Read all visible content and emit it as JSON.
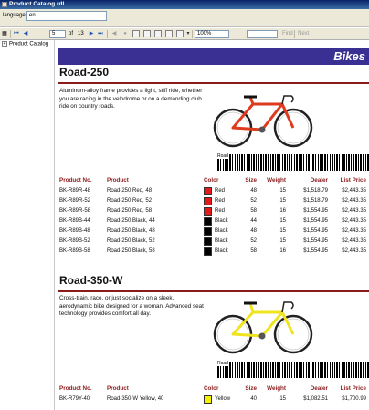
{
  "window": {
    "title": "Product Catalog.rdl"
  },
  "parameters": {
    "language_label": "language",
    "language_value": "en"
  },
  "toolbar": {
    "first": "⏮",
    "prev": "◀",
    "page_value": "5",
    "of_label": "of",
    "total_pages": "13",
    "next": "▶",
    "last": "⏭",
    "zoom": "100%",
    "find_label": "Find",
    "next_label": "Next",
    "icons": [
      "back-icon",
      "stop-icon",
      "refresh-icon",
      "print-icon",
      "print-layout-icon",
      "page-setup-icon",
      "export-icon"
    ]
  },
  "document_map": {
    "root": "Product Catalog"
  },
  "report": {
    "category": "Bikes",
    "columns": [
      "Product No.",
      "Product",
      "Color",
      "Size",
      "Weight",
      "Dealer",
      "List Price"
    ],
    "products": [
      {
        "name": "Road-250",
        "description": "Aluminum-alloy frame provides a light, stiff ride, whether you are racing in the velodrome or on a demanding club ride on country roads.",
        "frame_color": "#e03a1e",
        "rows": [
          {
            "no": "BK-R89R-48",
            "product": "Road-250 Red, 48",
            "color": "Red",
            "swatch": "#e31b1b",
            "size": "48",
            "weight": "15",
            "dealer": "$1,518.79",
            "price": "$2,443.35"
          },
          {
            "no": "BK-R89R-52",
            "product": "Road-250 Red, 52",
            "color": "Red",
            "swatch": "#e31b1b",
            "size": "52",
            "weight": "15",
            "dealer": "$1,518.79",
            "price": "$2,443.35"
          },
          {
            "no": "BK-R89R-58",
            "product": "Road-250 Red, 58",
            "color": "Red",
            "swatch": "#e31b1b",
            "size": "58",
            "weight": "16",
            "dealer": "$1,554.95",
            "price": "$2,443.35"
          },
          {
            "no": "BK-R89B-44",
            "product": "Road-250 Black, 44",
            "color": "Black",
            "swatch": "#000000",
            "size": "44",
            "weight": "15",
            "dealer": "$1,554.95",
            "price": "$2,443.35"
          },
          {
            "no": "BK-R89B-48",
            "product": "Road-250 Black, 48",
            "color": "Black",
            "swatch": "#000000",
            "size": "48",
            "weight": "15",
            "dealer": "$1,554.95",
            "price": "$2,443.35"
          },
          {
            "no": "BK-R89B-52",
            "product": "Road-250 Black, 52",
            "color": "Black",
            "swatch": "#000000",
            "size": "52",
            "weight": "15",
            "dealer": "$1,554.95",
            "price": "$2,443.35"
          },
          {
            "no": "BK-R89B-58",
            "product": "Road-250 Black, 58",
            "color": "Black",
            "swatch": "#000000",
            "size": "58",
            "weight": "16",
            "dealer": "$1,554.95",
            "price": "$2,443.35"
          }
        ]
      },
      {
        "name": "Road-350-W",
        "description": "Cross-train, race, or just socialize on a sleek, aerodynamic bike designed for a woman. Advanced seat technology provides comfort all day.",
        "frame_color": "#f0e41e",
        "rows": [
          {
            "no": "BK-R79Y-40",
            "product": "Road-350-W Yellow, 40",
            "color": "Yellow",
            "swatch": "#f5f000",
            "size": "40",
            "weight": "15",
            "dealer": "$1,082.51",
            "price": "$1,700.99"
          }
        ]
      }
    ]
  }
}
